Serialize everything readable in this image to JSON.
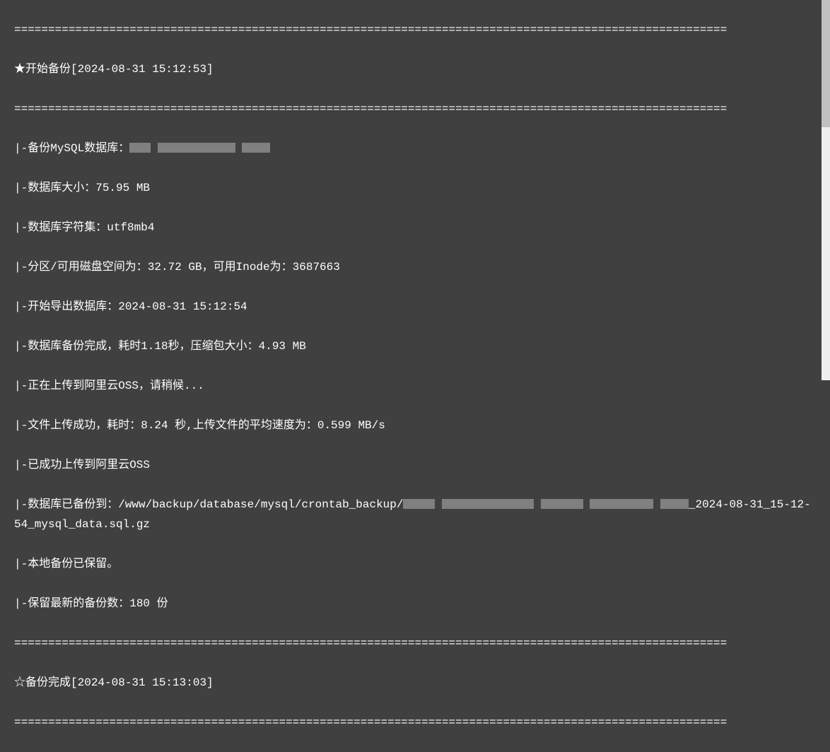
{
  "log": {
    "divider": "=========================================================================================================",
    "start_line_prefix": "★开始备份[",
    "start_timestamp": "2024-08-31 15:12:53",
    "start_line_suffix": "]",
    "db_label": "|-备份MySQL数据库：",
    "db_size_label": "|-数据库大小：",
    "db_size_value": "75.95 MB",
    "charset_label": "|-数据库字符集：",
    "charset_value": "utf8mb4",
    "disk_label": "|-分区/可用磁盘空间为：",
    "disk_value": "32.72 GB，可用Inode为：3687663",
    "export_label": "|-开始导出数据库：",
    "export_value": "2024-08-31 15:12:54",
    "backup_done_label": "|-数据库备份完成，耗时1.18秒，压缩包大小：",
    "backup_done_value": "4.93 MB",
    "uploading": "|-正在上传到阿里云OSS，请稍候...",
    "upload_done_label": "|-文件上传成功，耗时：",
    "upload_done_time": "8.24 秒",
    "upload_speed_label": ",上传文件的平均速度为：",
    "upload_speed_value": "0.599 MB/s",
    "upload_success": "|-已成功上传到阿里云OSS",
    "path_label": "|-数据库已备份到：",
    "path_value_prefix": "/www/backup/database/mysql/crontab_backup/",
    "path_value_suffix": "_2024-08-31_15-12-54_mysql_data.sql.gz",
    "local_kept": "|-本地备份已保留。",
    "keep_count_label": "|-保留最新的备份数：",
    "keep_count_value": "180 份",
    "end_line_prefix": "☆备份完成[",
    "end_timestamp": "2024-08-31 15:13:03",
    "end_line_suffix": "]"
  }
}
